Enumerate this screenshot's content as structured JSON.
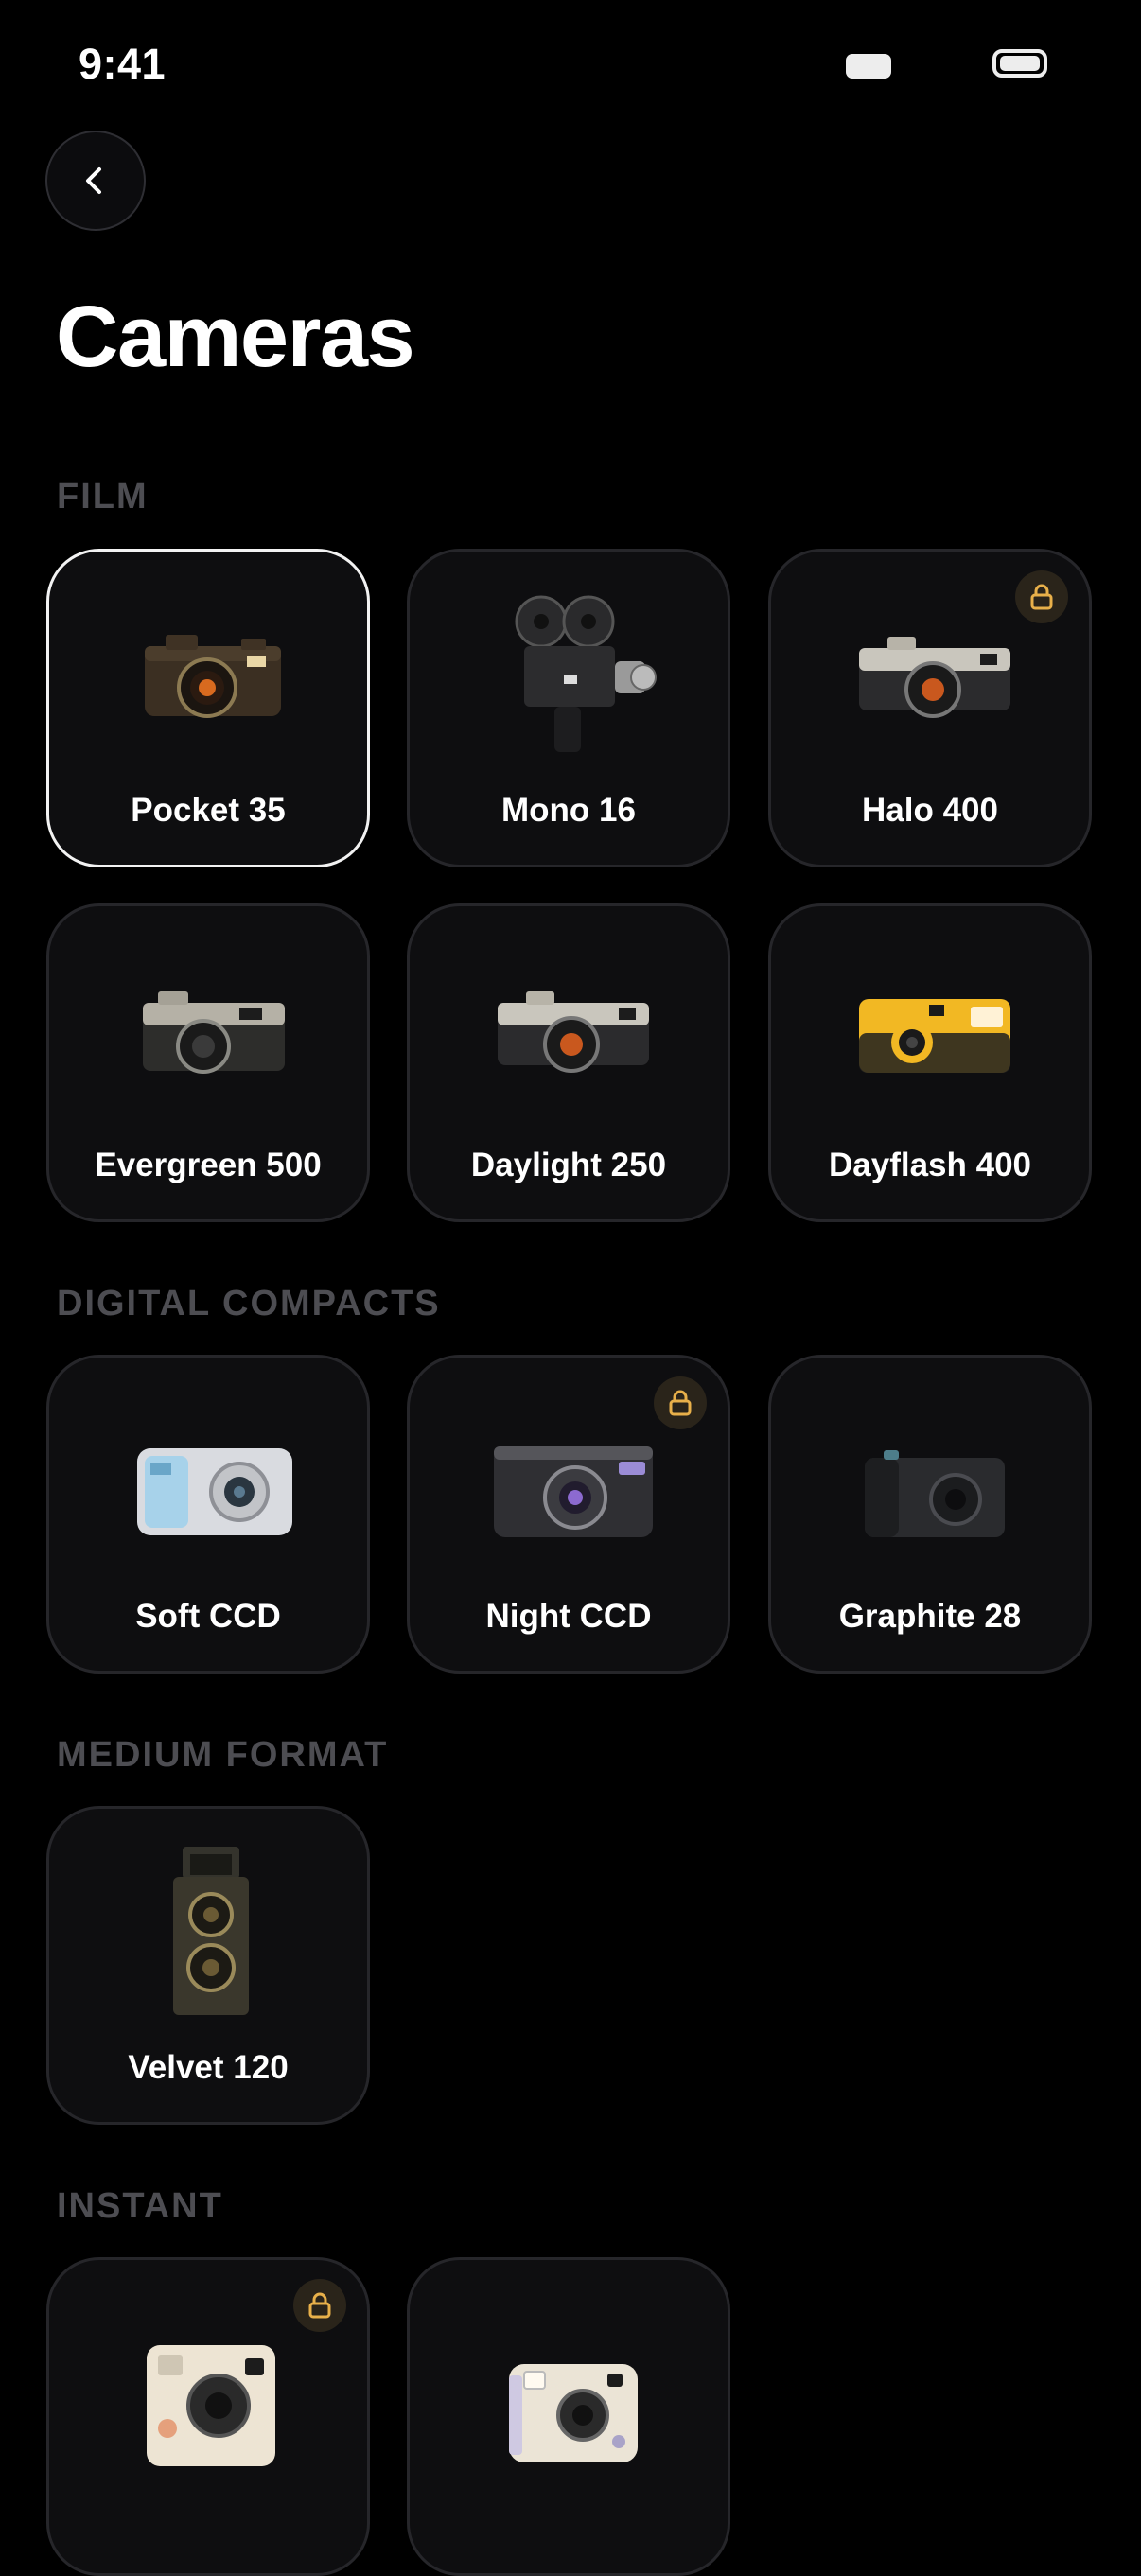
{
  "status_bar": {
    "time": "9:41"
  },
  "header": {
    "title": "Cameras"
  },
  "sections": [
    {
      "label": "FILM",
      "items": [
        {
          "label": "Pocket 35",
          "selected": true,
          "locked": false,
          "icon": "rangefinder-camera-brown"
        },
        {
          "label": "Mono 16",
          "selected": false,
          "locked": false,
          "icon": "movie-camera-black"
        },
        {
          "label": "Halo 400",
          "selected": false,
          "locked": true,
          "icon": "rangefinder-camera-silver"
        },
        {
          "label": "Evergreen 500",
          "selected": false,
          "locked": false,
          "icon": "rangefinder-camera-silver"
        },
        {
          "label": "Daylight 250",
          "selected": false,
          "locked": false,
          "icon": "rangefinder-camera-silver"
        },
        {
          "label": "Dayflash 400",
          "selected": false,
          "locked": false,
          "icon": "disposable-camera-yellow"
        }
      ]
    },
    {
      "label": "DIGITAL COMPACTS",
      "items": [
        {
          "label": "Soft CCD",
          "selected": false,
          "locked": false,
          "icon": "compact-camera-silver-blue"
        },
        {
          "label": "Night CCD",
          "selected": false,
          "locked": true,
          "icon": "compact-camera-black-purple"
        },
        {
          "label": "Graphite 28",
          "selected": false,
          "locked": false,
          "icon": "compact-camera-graphite"
        }
      ]
    },
    {
      "label": "MEDIUM FORMAT",
      "items": [
        {
          "label": "Velvet 120",
          "selected": false,
          "locked": false,
          "icon": "twin-lens-reflex-camera"
        }
      ]
    },
    {
      "label": "INSTANT",
      "items": [
        {
          "label": "",
          "selected": false,
          "locked": true,
          "icon": "instant-camera-cream-square"
        },
        {
          "label": "",
          "selected": false,
          "locked": false,
          "icon": "instant-camera-cream"
        }
      ]
    }
  ],
  "colors": {
    "background": "#000000",
    "card": "#0e0e10",
    "card_border": "#26262a",
    "selected_border": "#f2f2f2",
    "section_label": "#4d4d52",
    "lock_accent": "#e8b04a"
  }
}
